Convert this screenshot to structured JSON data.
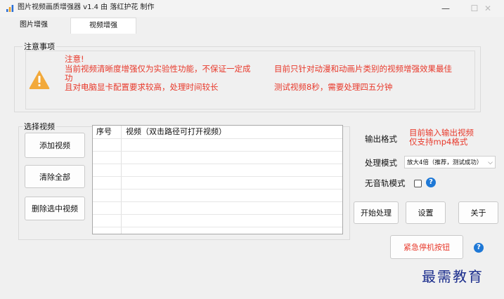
{
  "window": {
    "title": "图片视频画质增强器 v1.4   由 落红护花 制作",
    "minimize": "—",
    "maximize": "☐",
    "close": "✕"
  },
  "tabs": [
    {
      "label": "图片增强",
      "active": false
    },
    {
      "label": "视频增强",
      "active": true
    }
  ],
  "notice": {
    "group_label": "注意事项",
    "line1": "注意!",
    "line2": "当前视频清晰度增强仅为实验性功能，不保证一定成",
    "line3": "功",
    "line4": "且对电脑显卡配置要求较高，处理时间较长",
    "right1": "目前只针对动漫和动画片类别的视频增强效果最佳",
    "right2": "测试视频8秒，需要处理四五分钟"
  },
  "select_video": {
    "group_label": "选择视频",
    "add_button": "添加视频",
    "clear_button": "清除全部",
    "delete_button": "删除选中视频",
    "columns": [
      "序号",
      "视频（双击路径可打开视频）"
    ],
    "rows": []
  },
  "right_panel": {
    "output_format_label": "输出格式",
    "output_format_note1": "目前输入输出视频",
    "output_format_note2": "仅支持mp4格式",
    "mode_label": "处理模式",
    "mode_value": "放大4倍（推荐，测试成功）",
    "no_audio_label": "无音轨模式",
    "start_button": "开始处理",
    "settings_button": "设置",
    "about_button": "关于",
    "emergency_button": "紧急停机按钮",
    "help_icon": "?"
  },
  "watermark": "最需教育",
  "colors": {
    "warning_red": "#e8392b",
    "help_blue": "#1e78d6",
    "watermark_blue": "#1a2c8c"
  },
  "icons": {
    "app": "bar-chart-icon",
    "warning": "warning-triangle-icon",
    "help": "question-circle-icon"
  }
}
